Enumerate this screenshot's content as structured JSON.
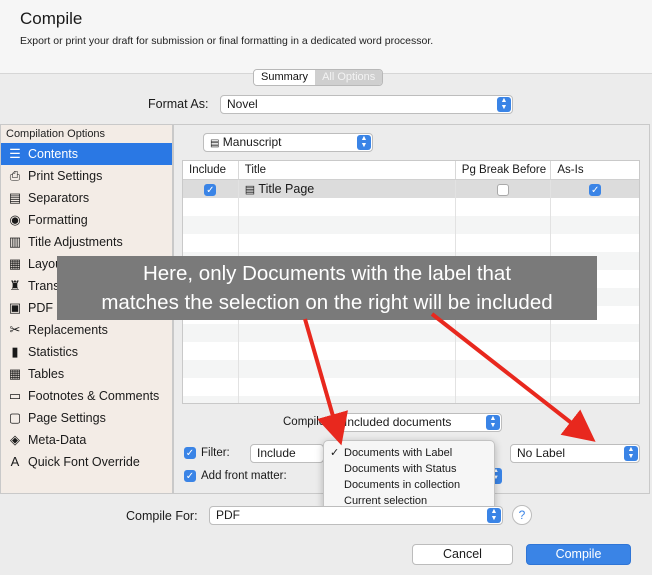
{
  "header": {
    "title": "Compile",
    "subtitle": "Export or print your draft for submission or final formatting in a dedicated word processor."
  },
  "tabs": [
    {
      "label": "Summary",
      "active": true
    },
    {
      "label": "All Options",
      "active": false
    }
  ],
  "format_as": {
    "label": "Format As:",
    "value": "Novel"
  },
  "sidebar": {
    "heading": "Compilation Options",
    "items": [
      {
        "label": "Contents",
        "icon": "contents-icon",
        "glyph": "☰",
        "selected": true
      },
      {
        "label": "Print Settings",
        "icon": "printer-icon",
        "glyph": "⎙",
        "selected": false
      },
      {
        "label": "Separators",
        "icon": "separators-icon",
        "glyph": "▤",
        "selected": false
      },
      {
        "label": "Formatting",
        "icon": "formatting-icon",
        "glyph": "◉",
        "selected": false
      },
      {
        "label": "Title Adjustments",
        "icon": "title-adjustments-icon",
        "glyph": "▥",
        "selected": false
      },
      {
        "label": "Layou",
        "icon": "layout-icon",
        "glyph": "▦",
        "selected": false
      },
      {
        "label": "Trans",
        "icon": "transformations-icon",
        "glyph": "♜",
        "selected": false
      },
      {
        "label": "PDF S",
        "icon": "pdf-settings-icon",
        "glyph": "▣",
        "selected": false
      },
      {
        "label": "Replacements",
        "icon": "replacements-icon",
        "glyph": "✂",
        "selected": false
      },
      {
        "label": "Statistics",
        "icon": "statistics-icon",
        "glyph": "▮",
        "selected": false
      },
      {
        "label": "Tables",
        "icon": "tables-icon",
        "glyph": "▦",
        "selected": false
      },
      {
        "label": "Footnotes & Comments",
        "icon": "footnotes-icon",
        "glyph": "▭",
        "selected": false
      },
      {
        "label": "Page Settings",
        "icon": "page-settings-icon",
        "glyph": "▢",
        "selected": false
      },
      {
        "label": "Meta-Data",
        "icon": "tag-icon",
        "glyph": "◈",
        "selected": false
      },
      {
        "label": "Quick Font Override",
        "icon": "font-override-icon",
        "glyph": "A",
        "selected": false
      }
    ]
  },
  "contents": {
    "collection_popup": "Manuscript",
    "columns": [
      "Include",
      "Title",
      "Pg Break Before",
      "As-Is"
    ],
    "rows": [
      {
        "include": true,
        "title": "Title Page",
        "pg_break_before": false,
        "as_is": true
      }
    ],
    "compile_label": "Compile:",
    "compile_value": "Included documents",
    "filter_label": "Filter:",
    "filter_mode": "Include",
    "filter_target": "No Label",
    "front_matter_label": "Add front matter:"
  },
  "filter_menu": {
    "items": [
      {
        "label": "Documents with Label",
        "checked": true
      },
      {
        "label": "Documents with Status",
        "checked": false
      },
      {
        "label": "Documents in collection",
        "checked": false
      },
      {
        "label": "Current selection",
        "checked": false
      }
    ]
  },
  "annotation": {
    "text_line1": "Here, only Documents with the label that",
    "text_line2": "matches the selection on the right will be included",
    "arrow_color": "#e8281e"
  },
  "compile_for": {
    "label": "Compile For:",
    "value": "PDF"
  },
  "buttons": {
    "cancel": "Cancel",
    "compile": "Compile",
    "help": "?"
  },
  "colors": {
    "accent": "#3a84e6",
    "sidebar_bg": "#f3ece6"
  }
}
